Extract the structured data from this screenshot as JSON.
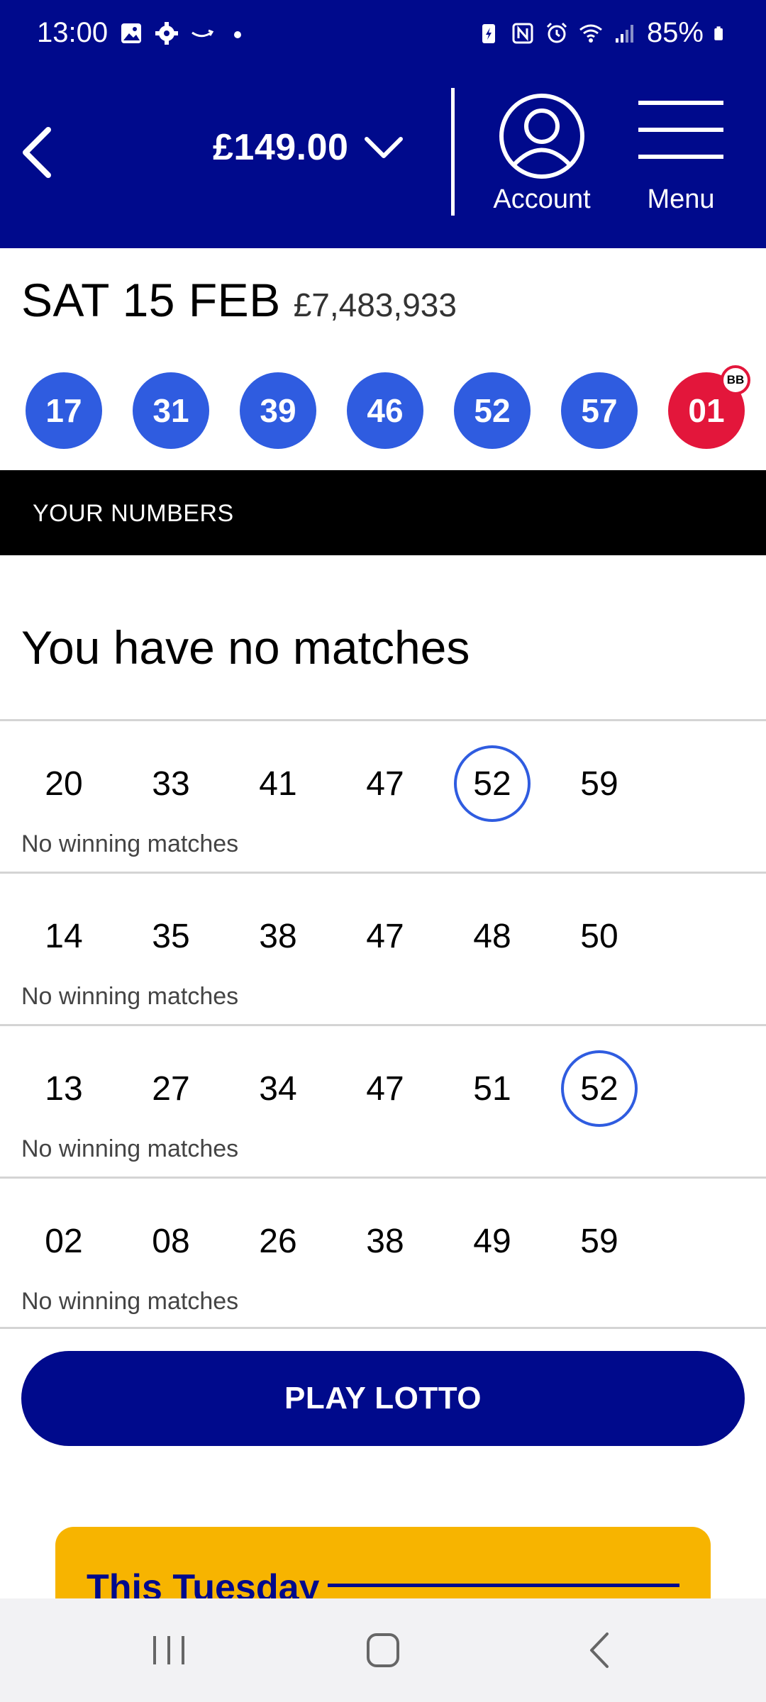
{
  "status_bar": {
    "time": "13:00",
    "battery": "85%",
    "left_icons": [
      "gallery-icon",
      "settings-icon",
      "amazon-icon",
      "dot-icon"
    ],
    "right_icons": [
      "battery-saver-icon",
      "nfc-icon",
      "alarm-icon",
      "wifi-icon",
      "signal-icon",
      "battery-icon"
    ]
  },
  "header": {
    "balance": "£149.00",
    "account_label": "Account",
    "menu_label": "Menu",
    "colors": {
      "background": "#000a8c",
      "text": "#ffffff"
    }
  },
  "draw": {
    "date": "SAT 15 FEB",
    "jackpot": "£7,483,933",
    "balls": [
      "17",
      "31",
      "39",
      "46",
      "52",
      "57"
    ],
    "bonus_ball": "01",
    "bonus_badge": "BB",
    "colors": {
      "ball": "#2f5ce0",
      "bonus": "#e3163b"
    }
  },
  "your_numbers": {
    "label": "YOUR NUMBERS",
    "summary": "You have no matches"
  },
  "lines": [
    {
      "numbers": [
        "20",
        "33",
        "41",
        "47",
        "52",
        "59"
      ],
      "matched": [
        false,
        false,
        false,
        false,
        true,
        false
      ],
      "status": "No winning matches"
    },
    {
      "numbers": [
        "14",
        "35",
        "38",
        "47",
        "48",
        "50"
      ],
      "matched": [
        false,
        false,
        false,
        false,
        false,
        false
      ],
      "status": "No winning matches"
    },
    {
      "numbers": [
        "13",
        "27",
        "34",
        "47",
        "51",
        "52"
      ],
      "matched": [
        false,
        false,
        false,
        false,
        false,
        true
      ],
      "status": "No winning matches"
    },
    {
      "numbers": [
        "02",
        "08",
        "26",
        "38",
        "49",
        "59"
      ],
      "matched": [
        false,
        false,
        false,
        false,
        false,
        false
      ],
      "status": "No winning matches"
    }
  ],
  "play_button": {
    "label": "PLAY LOTTO"
  },
  "promo": {
    "title": "This Tuesday",
    "color": "#f7b400"
  },
  "nav_bar": {
    "icons": [
      "recent-apps-icon",
      "home-icon",
      "back-icon"
    ]
  }
}
